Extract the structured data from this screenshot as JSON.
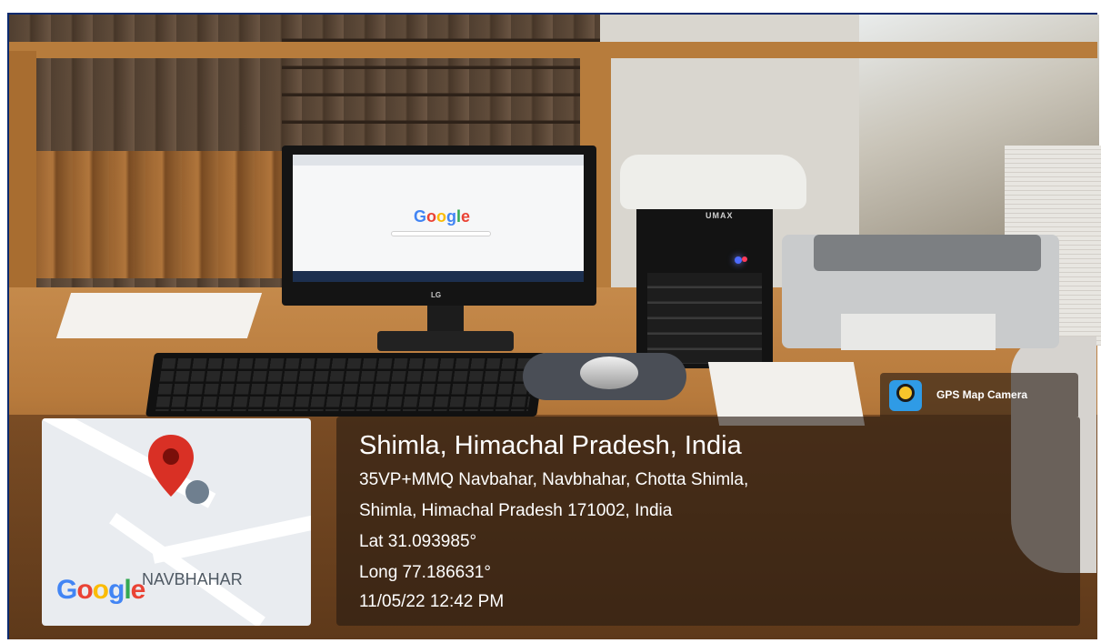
{
  "screen_content": {
    "google_logo_letters": [
      "G",
      "o",
      "o",
      "g",
      "l",
      "e"
    ],
    "monitor_brand": "LG",
    "cpu_brand": "UMAX"
  },
  "gps_badge": {
    "label": "GPS Map Camera",
    "icon": "camera-lens-icon"
  },
  "location": {
    "title": "Shimla, Himachal Pradesh, India",
    "address_line1": "35VP+MMQ Navbahar, Navbhahar, Chotta Shimla,",
    "address_line2": "Shimla, Himachal Pradesh 171002, India",
    "latitude": "Lat 31.093985°",
    "longitude": "Long 77.186631°",
    "datetime": "11/05/22 12:42 PM"
  },
  "map": {
    "place_label": "NAVBHAHAR",
    "google_letters": [
      "G",
      "o",
      "o",
      "g",
      "l",
      "e"
    ],
    "pin_icon": "map-pin-icon",
    "colors": {
      "pin": "#d93025",
      "google_blue": "#4285f4",
      "google_red": "#ea4335",
      "google_yellow": "#fbbc05",
      "google_green": "#34a853"
    }
  }
}
